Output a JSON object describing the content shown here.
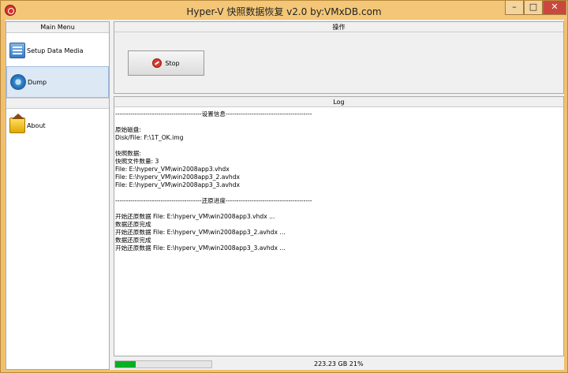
{
  "window": {
    "title": "Hyper-V 快照数据恢复 v2.0 by:VMxDB.com",
    "minimize_glyph": "–",
    "maximize_glyph": "□",
    "close_glyph": "✕"
  },
  "sidebar": {
    "header": "Main Menu",
    "items": [
      {
        "label": "Setup Data Media",
        "icon": "setup-data-media-icon",
        "active": false
      },
      {
        "label": "Dump",
        "icon": "dump-gear-icon",
        "active": true
      },
      {
        "label": "About",
        "icon": "about-house-icon",
        "active": false
      }
    ]
  },
  "operations": {
    "header": "操作",
    "stop_label": "Stop"
  },
  "log": {
    "header": "Log",
    "lines": [
      "----------------------------------------设置信息----------------------------------------",
      "",
      "原始磁盘:",
      "Disk/File: F:\\1T_OK.img",
      "",
      "快照数据:",
      "快照文件数量: 3",
      "File: E:\\hyperv_VM\\win2008app3.vhdx",
      "File: E:\\hyperv_VM\\win2008app3_2.avhdx",
      "File: E:\\hyperv_VM\\win2008app3_3.avhdx",
      "",
      "----------------------------------------还原进度----------------------------------------",
      "",
      "开始还原数据 File: E:\\hyperv_VM\\win2008app3.vhdx ...",
      "数据还原完成",
      "开始还原数据 File: E:\\hyperv_VM\\win2008app3_2.avhdx ...",
      "数据还原完成",
      "开始还原数据 File: E:\\hyperv_VM\\win2008app3_3.avhdx ..."
    ]
  },
  "status": {
    "progress_fraction": 0.21,
    "progress_color": "#06b025",
    "text": "223.23 GB  21%"
  }
}
